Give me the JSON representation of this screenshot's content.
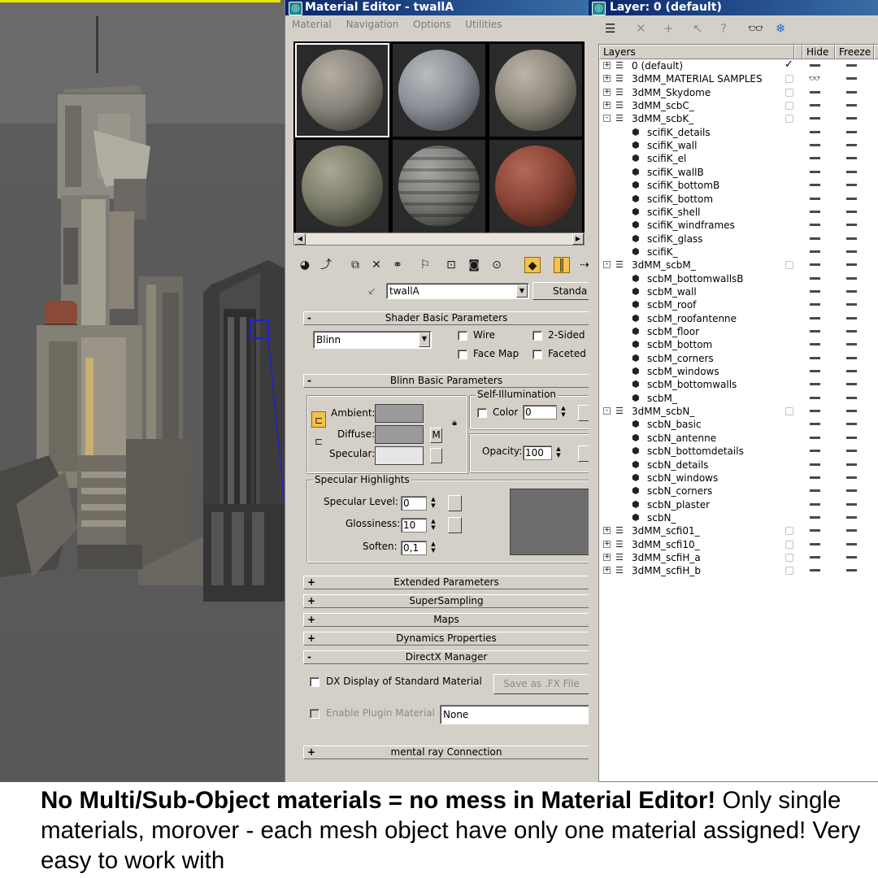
{
  "material_editor": {
    "title": "Material Editor - twallA",
    "menu": [
      "Material",
      "Navigation",
      "Options",
      "Utilities"
    ],
    "material_name": "twallA",
    "type_button": "Standa",
    "shader_rollout": {
      "label": "Shader Basic Parameters",
      "shader": "Blinn",
      "wire": "Wire",
      "two_sided": "2-Sided",
      "face_map": "Face Map",
      "faceted": "Faceted"
    },
    "blinn_rollout": {
      "label": "Blinn Basic Parameters",
      "self_illumination": "Self-Illumination",
      "color_label": "Color",
      "color_value": "0",
      "ambient": "Ambient:",
      "diffuse": "Diffuse:",
      "specular": "Specular:",
      "map_button": "M",
      "opacity_label": "Opacity:",
      "opacity_value": "100",
      "specular_highlights": "Specular Highlights",
      "specular_level_label": "Specular Level:",
      "specular_level_value": "0",
      "glossiness_label": "Glossiness:",
      "glossiness_value": "10",
      "soften_label": "Soften:",
      "soften_value": "0,1"
    },
    "rollouts_collapsed": [
      "Extended Parameters",
      "SuperSampling",
      "Maps",
      "Dynamics Properties"
    ],
    "directx": {
      "label": "DirectX Manager",
      "dx_display": "DX Display of Standard Material",
      "save_fx": "Save as .FX File",
      "enable_plugin": "Enable Plugin Material",
      "plugin_value": "None"
    },
    "mental_ray": "mental ray Connection"
  },
  "layer_manager": {
    "title": "Layer: 0 (default)",
    "columns": [
      "Layers",
      "Hide",
      "Freeze"
    ],
    "rows": [
      {
        "name": "0 (default)",
        "level": 0,
        "expander": "+",
        "active": true
      },
      {
        "name": "3dMM_MATERIAL SAMPLES",
        "level": 0,
        "expander": "+",
        "hidden": true
      },
      {
        "name": "3dMM_Skydome",
        "level": 0,
        "expander": "+"
      },
      {
        "name": "3dMM_scbC_",
        "level": 0,
        "expander": "+"
      },
      {
        "name": "3dMM_scbK_",
        "level": 0,
        "expander": "-"
      },
      {
        "name": "scifiK_details",
        "level": 1
      },
      {
        "name": "scifiK_wall",
        "level": 1
      },
      {
        "name": "scifiK_el",
        "level": 1
      },
      {
        "name": "scifiK_wallB",
        "level": 1
      },
      {
        "name": "scifiK_bottomB",
        "level": 1
      },
      {
        "name": "scifiK_bottom",
        "level": 1
      },
      {
        "name": "scifiK_shell",
        "level": 1
      },
      {
        "name": "scifiK_windframes",
        "level": 1
      },
      {
        "name": "scifiK_glass",
        "level": 1
      },
      {
        "name": "scifiK_",
        "level": 1
      },
      {
        "name": "3dMM_scbM_",
        "level": 0,
        "expander": "-"
      },
      {
        "name": "scbM_bottomwallsB",
        "level": 1
      },
      {
        "name": "scbM_wall",
        "level": 1
      },
      {
        "name": "scbM_roof",
        "level": 1
      },
      {
        "name": "scbM_roofantenne",
        "level": 1
      },
      {
        "name": "scbM_floor",
        "level": 1
      },
      {
        "name": "scbM_bottom",
        "level": 1
      },
      {
        "name": "scbM_corners",
        "level": 1
      },
      {
        "name": "scbM_windows",
        "level": 1
      },
      {
        "name": "scbM_bottomwalls",
        "level": 1
      },
      {
        "name": "scbM_",
        "level": 1
      },
      {
        "name": "3dMM_scbN_",
        "level": 0,
        "expander": "-"
      },
      {
        "name": "scbN_basic",
        "level": 1
      },
      {
        "name": "scbN_antenne",
        "level": 1
      },
      {
        "name": "scbN_bottomdetails",
        "level": 1
      },
      {
        "name": "scbN_details",
        "level": 1
      },
      {
        "name": "scbN_windows",
        "level": 1
      },
      {
        "name": "scbN_corners",
        "level": 1
      },
      {
        "name": "scbN_plaster",
        "level": 1
      },
      {
        "name": "scbN_",
        "level": 1
      },
      {
        "name": "3dMM_scfi01_",
        "level": 0,
        "expander": "+"
      },
      {
        "name": "3dMM_scfi10_",
        "level": 0,
        "expander": "+"
      },
      {
        "name": "3dMM_scfiH_a",
        "level": 0,
        "expander": "+"
      },
      {
        "name": "3dMM_scfiH_b",
        "level": 0,
        "expander": "+"
      }
    ]
  },
  "caption": {
    "bold": "No Multi/Sub-Object materials = no mess in Material Editor!",
    "rest": " Only single materials, morover - each mesh object have only one material assigned! Very easy to work with"
  },
  "colors": {
    "title_bar": "#0a246a",
    "panel_bg": "#d4d0c8",
    "active_tool": "#f3c24a"
  }
}
